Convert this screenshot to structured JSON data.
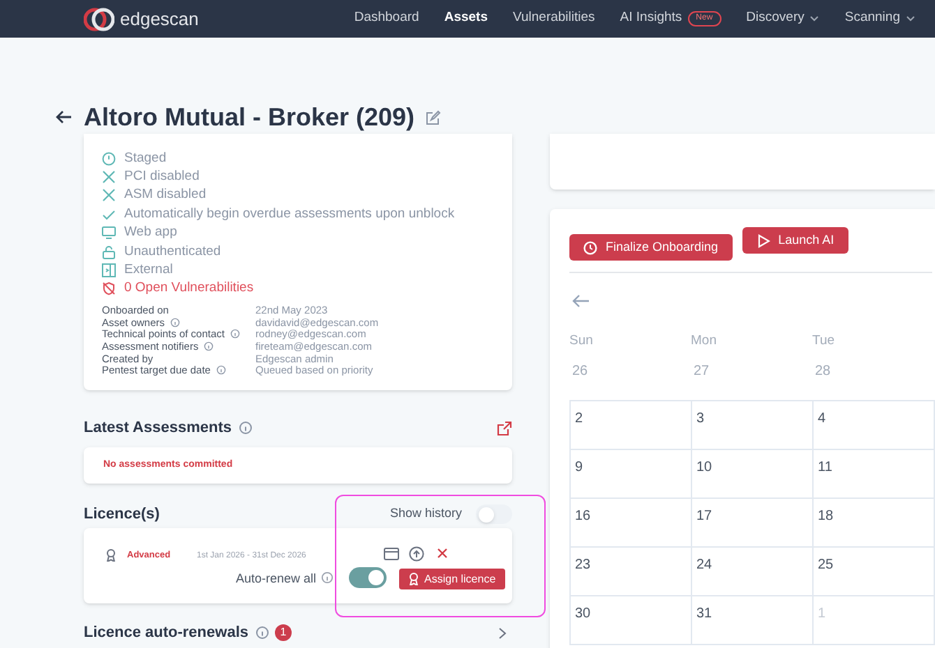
{
  "nav": {
    "logo": "edgescan",
    "items": [
      {
        "label": "Dashboard",
        "selected": false
      },
      {
        "label": "Assets",
        "selected": true
      },
      {
        "label": "Vulnerabilities",
        "selected": false
      },
      {
        "label": "AI Insights",
        "selected": false,
        "badge": "New"
      },
      {
        "label": "Discovery",
        "selected": false,
        "dropdown": true
      },
      {
        "label": "Scanning",
        "selected": false,
        "dropdown": true
      }
    ]
  },
  "page": {
    "title": "Altoro Mutual - Broker (209)"
  },
  "details": [
    {
      "kind": "clock",
      "text": "Staged",
      "alert": false
    },
    {
      "kind": "cross",
      "text": "PCI disabled",
      "alert": false
    },
    {
      "kind": "cross",
      "text": "ASM disabled",
      "alert": false
    },
    {
      "kind": "check",
      "text": "Automatically begin overdue assessments upon unblock",
      "alert": false
    },
    {
      "kind": "monitor",
      "text": "Web app",
      "alert": false
    },
    {
      "kind": "lock",
      "text": "Unauthenticated",
      "alert": false
    },
    {
      "kind": "external",
      "text": "External",
      "alert": false
    },
    {
      "kind": "bug",
      "text": "0 Open Vulnerabilities",
      "alert": true
    }
  ],
  "meta": [
    {
      "label": "Onboarded on",
      "info": false,
      "value": "22nd May 2023"
    },
    {
      "label": "Asset owners",
      "info": true,
      "value": "davidavid@edgescan.com"
    },
    {
      "label": "Technical points of contact",
      "info": true,
      "value": "rodney@edgescan.com"
    },
    {
      "label": "Assessment notifiers",
      "info": true,
      "value": "fireteam@edgescan.com"
    },
    {
      "label": "Created by",
      "info": false,
      "value": "Edgescan admin"
    },
    {
      "label": "Pentest target due date",
      "info": true,
      "value": "Queued based on priority"
    }
  ],
  "assessments": {
    "title": "Latest Assessments",
    "message": "No assessments committed"
  },
  "licences": {
    "title": "Licence(s)",
    "show_history": {
      "label": "Show history",
      "on": false
    },
    "licence": {
      "tier": "Advanced",
      "dates": "1st Jan 2026 - 31st Dec 2026"
    },
    "auto_renew": {
      "label": "Auto-renew all",
      "on": true
    },
    "assign_label": "Assign licence"
  },
  "auto_renewals": {
    "title": "Licence auto-renewals",
    "count": "1"
  },
  "actions": [
    "Finalize Onboarding",
    "Launch AI"
  ],
  "calendar": {
    "days": [
      {
        "name": "Sun",
        "date": "26"
      },
      {
        "name": "Mon",
        "date": "27"
      },
      {
        "name": "Tue",
        "date": "28"
      }
    ],
    "weeks": [
      [
        {
          "date": "2",
          "muted": false
        },
        {
          "date": "3",
          "muted": false
        },
        {
          "date": "4",
          "muted": false
        }
      ],
      [
        {
          "date": "9",
          "muted": false
        },
        {
          "date": "10",
          "muted": false
        },
        {
          "date": "11",
          "muted": false
        }
      ],
      [
        {
          "date": "16",
          "muted": false
        },
        {
          "date": "17",
          "muted": false
        },
        {
          "date": "18",
          "muted": false
        }
      ],
      [
        {
          "date": "23",
          "muted": false
        },
        {
          "date": "24",
          "muted": false
        },
        {
          "date": "25",
          "muted": false
        }
      ],
      [
        {
          "date": "30",
          "muted": false
        },
        {
          "date": "31",
          "muted": false
        },
        {
          "date": "1",
          "muted": true
        }
      ]
    ]
  }
}
